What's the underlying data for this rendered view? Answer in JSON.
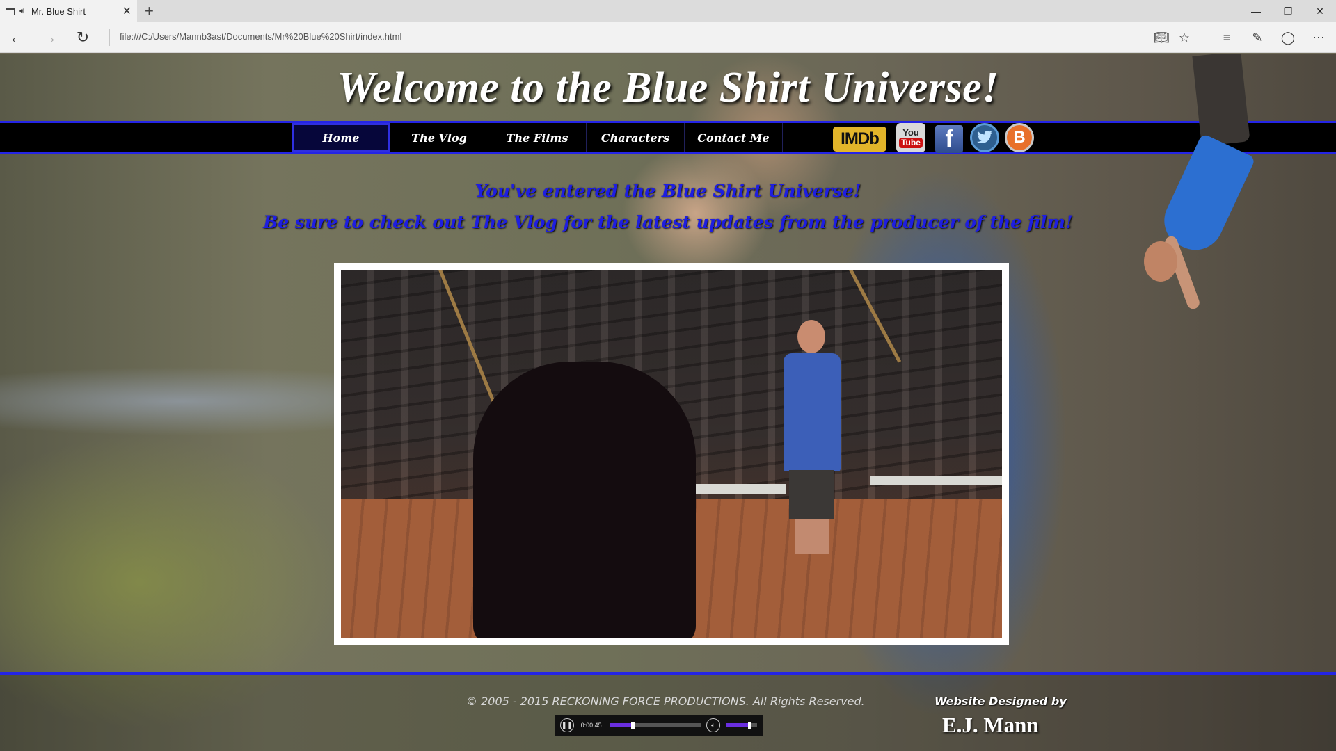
{
  "browser": {
    "tab_title": "Mr. Blue Shirt",
    "url": "file:///C:/Users/Mannb3ast/Documents/Mr%20Blue%20Shirt/index.html",
    "tab_close_glyph": "✕",
    "new_tab_glyph": "+"
  },
  "page": {
    "header_title": "Welcome to the Blue Shirt Universe!",
    "nav_items": [
      {
        "label": "Home",
        "active": true
      },
      {
        "label": "The Vlog",
        "active": false
      },
      {
        "label": "The Films",
        "active": false
      },
      {
        "label": "Characters",
        "active": false
      },
      {
        "label": "Contact Me",
        "active": false
      }
    ],
    "social": {
      "imdb": "IMDb",
      "youtube_top": "You",
      "youtube_bottom": "Tube",
      "facebook": "f",
      "twitter_icon": "twitter-icon",
      "blogger": "B"
    },
    "message_line_1": "You've entered the Blue Shirt Universe!",
    "message_line_2": "Be sure to check out The Vlog for the latest updates from the producer of the film!",
    "footer": {
      "copyright": "© 2005 - 2015 RECKONING FORCE PRODUCTIONS. All Rights Reserved.",
      "designed_by_label": "Website Designed by",
      "designer_name": "E.J. Mann"
    },
    "audio_player": {
      "time": "0:00:45",
      "progress_fraction": 0.25,
      "volume_fraction": 0.75
    }
  },
  "colors": {
    "accent_blue": "#2424e6",
    "message_blue": "#1e1ee0",
    "nav_bg": "#000000",
    "imdb_gold": "#e2b52a",
    "player_progress": "#6a2ee0"
  }
}
